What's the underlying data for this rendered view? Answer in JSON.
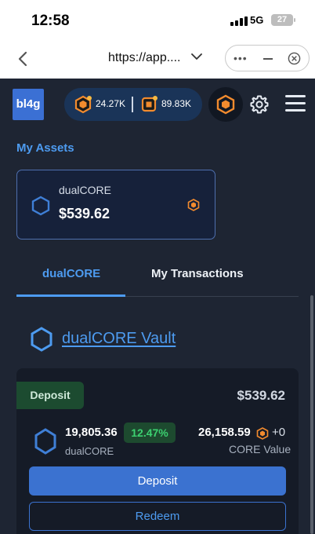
{
  "status": {
    "time": "12:58",
    "network": "5G",
    "battery": "27"
  },
  "browser": {
    "url": "https://app...."
  },
  "header": {
    "logo": "bl4g",
    "balance_1": "24.27K",
    "balance_2": "89.83K"
  },
  "assets": {
    "title": "My Assets",
    "card": {
      "name": "dualCORE",
      "value": "$539.62"
    }
  },
  "tabs": [
    {
      "label": "dualCORE",
      "active": true
    },
    {
      "label": "My Transactions",
      "active": false
    }
  ],
  "vault": {
    "title": "dualCORE Vault",
    "badge": "Deposit",
    "total": "$539.62",
    "amount": "19,805.36",
    "apy": "12.47%",
    "amount_label": "dualCORE",
    "core_value": "26,158.59",
    "core_delta": "+0",
    "core_label": "CORE Value",
    "deposit_button": "Deposit",
    "redeem_button": "Redeem"
  },
  "colors": {
    "background": "#1e2533",
    "accent_blue": "#4d9bf0",
    "button_blue": "#3b72d0",
    "core_orange": "#f28b2e",
    "apy_green": "#3cd070"
  },
  "icons": {
    "back": "chevron-left-icon",
    "url_dropdown": "chevron-down-icon",
    "more": "more-dots-icon",
    "minimize": "minimize-icon",
    "close": "close-circle-icon",
    "settings": "gear-icon",
    "menu": "hamburger-menu-icon",
    "token": "hexagon-icon",
    "core": "core-token-icon"
  }
}
